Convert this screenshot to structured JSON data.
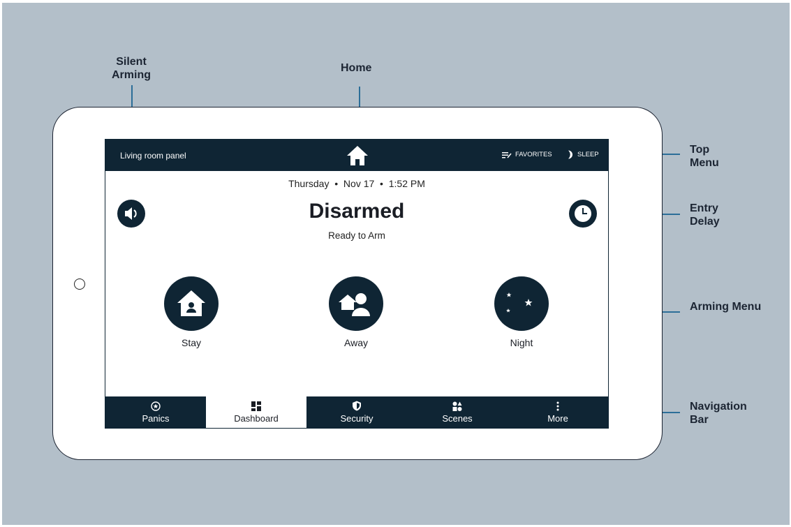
{
  "annotations": {
    "silent_arming": [
      "Silent",
      "Arming"
    ],
    "home": "Home",
    "top_menu": [
      "Top",
      "Menu"
    ],
    "entry_delay": [
      "Entry",
      "Delay"
    ],
    "arming_menu": "Arming Menu",
    "navigation_bar": [
      "Navigation",
      "Bar"
    ]
  },
  "topbar": {
    "panel_name": "Living room panel",
    "favorites_label": "FAVORITES",
    "sleep_label": "SLEEP"
  },
  "status": {
    "day": "Thursday",
    "date": "Nov 17",
    "time": "1:52 PM",
    "state": "Disarmed",
    "substate": "Ready to Arm"
  },
  "arming": [
    {
      "label": "Stay",
      "icon": "house-person-icon"
    },
    {
      "label": "Away",
      "icon": "person-leaving-house-icon"
    },
    {
      "label": "Night",
      "icon": "moon-stars-icon"
    }
  ],
  "nav": [
    {
      "label": "Panics",
      "icon": "shield-star-icon",
      "active": false
    },
    {
      "label": "Dashboard",
      "icon": "dashboard-grid-icon",
      "active": true
    },
    {
      "label": "Security",
      "icon": "shield-icon",
      "active": false
    },
    {
      "label": "Scenes",
      "icon": "scenes-icon",
      "active": false
    },
    {
      "label": "More",
      "icon": "more-vertical-icon",
      "active": false
    }
  ],
  "colors": {
    "background": "#b3bfc9",
    "panel_dark": "#0f2534",
    "annotation_line": "#2c6e98",
    "annotation_text": "#1c2533"
  }
}
